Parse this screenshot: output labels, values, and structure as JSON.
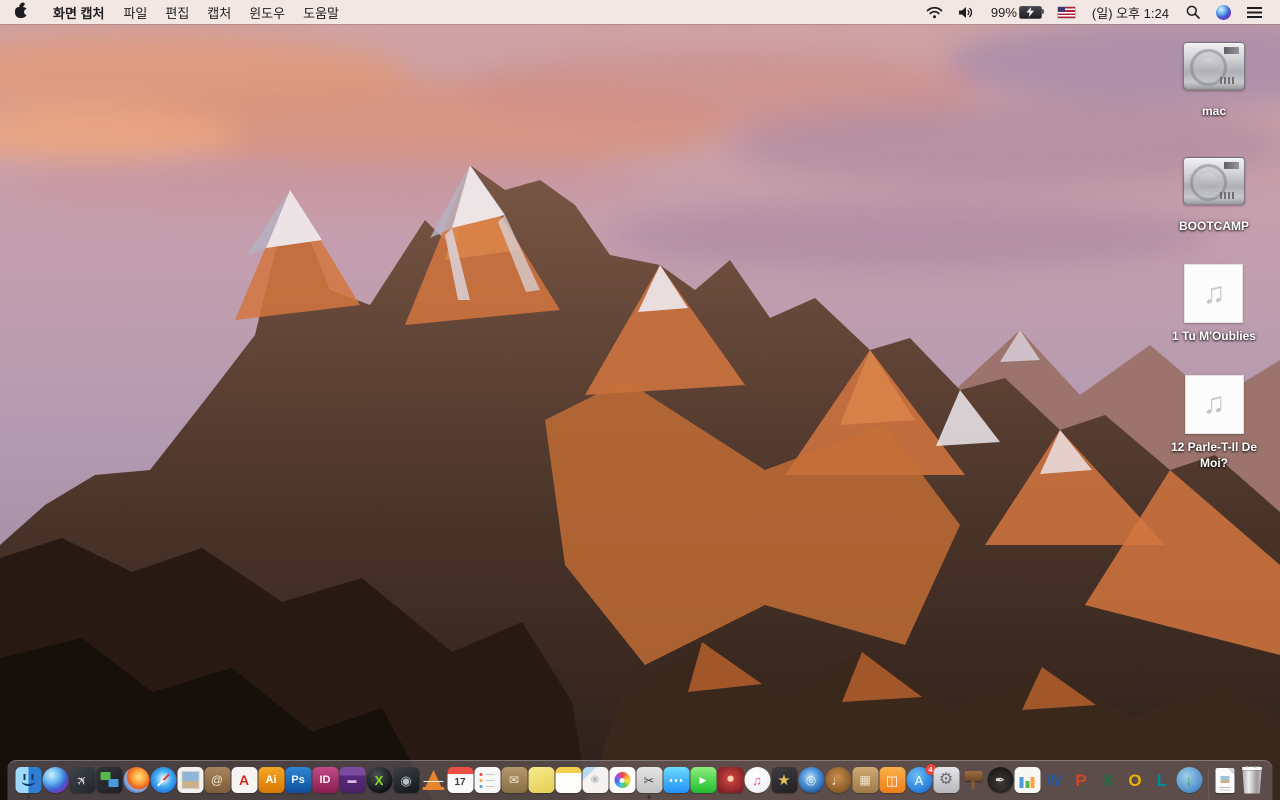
{
  "menu_bar": {
    "app_name": "화면 캡처",
    "menus": [
      "파일",
      "편집",
      "캡처",
      "윈도우",
      "도움말"
    ],
    "status": {
      "battery_percent": "99%",
      "clock": "(일) 오후 1:24"
    },
    "colors": {
      "bar_bg": "#f4e9e6",
      "text": "#1d1d1f"
    }
  },
  "desktop": {
    "icons": [
      {
        "name": "volume-mac",
        "kind": "hdd",
        "label": "mac"
      },
      {
        "name": "volume-bootcamp",
        "kind": "hdd",
        "label": "BOOTCAMP"
      },
      {
        "name": "audio-file-1-tu-moublies",
        "kind": "audio",
        "label": "1 Tu M'Oublies",
        "glyph": "♫"
      },
      {
        "name": "audio-file-12-parle-t-il-de-moi",
        "kind": "audio",
        "label": "12 Parle-T-Il De Moi?",
        "glyph": "♫"
      }
    ]
  },
  "dock": {
    "apps": [
      {
        "name": "finder",
        "cls": "ic-finder",
        "shape": "s",
        "bg": "linear-gradient(90deg,#9fd8fb 0%,#9fd8fb 50%,#2e7fd4 50%,#2e7fd4 100%)",
        "running": true
      },
      {
        "name": "siri",
        "shape": "c",
        "bg": "radial-gradient(circle at 35% 30%,#cfeffc 0%,#5fb2ee 35%,#3b5fd0 60%,#8a2ec2 80%,#1a0f3d 100%)"
      },
      {
        "name": "launchpad",
        "shape": "s",
        "bg": "linear-gradient(145deg,#3e444c,#22262b)",
        "glyph": "✈",
        "fg": "#cdd2d9",
        "fs": 13,
        "rot": -45
      },
      {
        "name": "mission-control",
        "cls": "ic-mc",
        "shape": "s",
        "bg": "linear-gradient(145deg,#31353a,#1c1f23)"
      },
      {
        "name": "firefox",
        "shape": "c",
        "bg": "radial-gradient(circle at 60% 38%,#ffe27a 0%,#f9a13c 30%,#ea5b1e 52%,#8fb0e0 58%,#2a4f9e 90%)"
      },
      {
        "name": "safari",
        "cls": "ic-safari",
        "shape": "c",
        "bg": "radial-gradient(circle at 50% 45%,#eaf6fd 0%,#bfe4fa 14%,#47aef2 40%,#1565d8 85%)"
      },
      {
        "name": "preview",
        "cls": "ic-preview",
        "shape": "s",
        "bg": "#f2f1ef"
      },
      {
        "name": "contacts",
        "shape": "s",
        "bg": "linear-gradient(180deg,#a8845c,#7b5d3c)",
        "glyph": "@",
        "fg": "#f3e8d2",
        "fs": 12
      },
      {
        "name": "acrobat-reader",
        "shape": "s",
        "bg": "#f5f4f2",
        "glyph": "A",
        "fg": "#d0281e",
        "fs": 14,
        "wt": 700
      },
      {
        "name": "illustrator",
        "shape": "s",
        "bg": "linear-gradient(180deg,#f5a623,#d67a06)",
        "glyph": "Ai",
        "fg": "#ffffff",
        "fs": 11,
        "wt": 700
      },
      {
        "name": "photoshop",
        "shape": "s",
        "bg": "linear-gradient(180deg,#2f86d3,#0f4f9a)",
        "glyph": "Ps",
        "fg": "#eaf4ff",
        "fs": 11,
        "wt": 700
      },
      {
        "name": "indesign",
        "shape": "s",
        "bg": "linear-gradient(180deg,#c24a86,#8a1d52)",
        "glyph": "ID",
        "fg": "#fdeef6",
        "fs": 11,
        "wt": 700
      },
      {
        "name": "toast-burner",
        "shape": "s",
        "bg": "linear-gradient(180deg,#7b4ba0 0%,#7b4ba0 32%,#56297a 32%,#4a2268 100%)",
        "glyph": "▬",
        "fg": "#d3bde4",
        "fs": 9
      },
      {
        "name": "x-converter",
        "shape": "c",
        "bg": "radial-gradient(circle at 40% 32%,#4c5156,#0e1012 75%)",
        "glyph": "X",
        "fg": "#8ddc2a",
        "fs": 13,
        "wt": 700
      },
      {
        "name": "disk-tool",
        "shape": "s",
        "bg": "linear-gradient(160deg,#3c4046,#15171a)",
        "glyph": "◉",
        "fg": "#b9c2cc",
        "fs": 13
      },
      {
        "name": "vlc",
        "cls": "ic-vlc",
        "shape": "n"
      },
      {
        "name": "calendar",
        "shape": "s",
        "bg": "linear-gradient(180deg,#ec5044 0px,#ec5044 7px,#fbfbfb 7px)",
        "glyph": "17",
        "fg": "#3a3a3c",
        "fs": 10,
        "wt": 700,
        "mt": 6
      },
      {
        "name": "reminders",
        "cls": "ic-rem",
        "shape": "s",
        "bg": "#f7f7f7"
      },
      {
        "name": "mail-archive-box",
        "shape": "s",
        "bg": "linear-gradient(180deg,#b5986b,#8a6f44)",
        "glyph": "✉",
        "fg": "#efe6d4",
        "fs": 12
      },
      {
        "name": "stickies",
        "shape": "s",
        "bg": "linear-gradient(160deg,#f6e98a,#e6cf55)"
      },
      {
        "name": "notes",
        "shape": "s",
        "bg": "linear-gradient(180deg,#f3cf4e 0px,#f3cf4e 6px,#fdfdfb 6px)"
      },
      {
        "name": "documents-seal",
        "shape": "s",
        "bg": "linear-gradient(135deg,#bcd9f2 0%,#bcd9f2 26%,#f4f3f1 26%)",
        "glyph": "◉",
        "fg": "#b9b9bd",
        "fs": 10
      },
      {
        "name": "photos",
        "cls": "ic-photos",
        "shape": "s",
        "bg": "#fbfbfb"
      },
      {
        "name": "screen-capture",
        "shape": "s",
        "bg": "linear-gradient(180deg,#e5e5e5,#c2c2c4)",
        "glyph": "✂",
        "fg": "#46464a",
        "fs": 13,
        "running": true
      },
      {
        "name": "messages",
        "shape": "s",
        "bg": "linear-gradient(180deg,#6edcfc,#1f8ff7)",
        "glyph": "⋯",
        "fg": "#ffffff",
        "fs": 15,
        "wt": 700
      },
      {
        "name": "facetime",
        "shape": "s",
        "bg": "linear-gradient(180deg,#8dee7c,#1fbe2e)",
        "glyph": "▶",
        "fg": "#ffffff",
        "fs": 9
      },
      {
        "name": "photo-booth",
        "shape": "s",
        "bg": "radial-gradient(circle at 50% 45%,#f6d3a8 0%,#f6d3a8 14%,#c2403e 18%,#7a1b22 90%)"
      },
      {
        "name": "itunes",
        "shape": "c",
        "bg": "radial-gradient(circle at 40% 35%,#ffffff 0%,#f4f4f8 60%,#d9d9e2 100%)",
        "glyph": "♫",
        "fg": "#e14e8c",
        "fs": 13
      },
      {
        "name": "imovie",
        "shape": "s",
        "bg": "linear-gradient(160deg,#3e3e42,#202024)",
        "glyph": "★",
        "fg": "#e3c05a",
        "fs": 15
      },
      {
        "name": "dvd-player",
        "shape": "c",
        "bg": "radial-gradient(circle at 45% 40%,#bfe0f5 0%,#4e94d8 40%,#113f85 90%)",
        "glyph": "◎",
        "fg": "rgba(255,255,255,0.8)",
        "fs": 12
      },
      {
        "name": "garageband",
        "shape": "c",
        "bg": "radial-gradient(circle at 45% 40%,#c98f4e,#7e5222 80%)",
        "glyph": "♩",
        "fg": "#f6e8cf",
        "fs": 13
      },
      {
        "name": "bulletin-board",
        "shape": "s",
        "bg": "linear-gradient(180deg,#cfa873,#a07a48)",
        "glyph": "▦",
        "fg": "#f0e4cc",
        "fs": 12
      },
      {
        "name": "ibooks",
        "shape": "s",
        "bg": "linear-gradient(180deg,#f9b24a,#ee7d1c)",
        "glyph": "◫",
        "fg": "#ffffff",
        "fs": 13
      },
      {
        "name": "app-store",
        "shape": "c",
        "bg": "radial-gradient(circle at 40% 32%,#6cc1f5,#2071d6 80%)",
        "glyph": "A",
        "fg": "#ffffff",
        "fs": 13,
        "badge": "4"
      },
      {
        "name": "system-preferences",
        "shape": "s",
        "bg": "linear-gradient(180deg,#e6e6e9,#b6b6bd)",
        "glyph": "⚙",
        "fg": "#6b6b72",
        "fs": 16
      },
      {
        "name": "keynote-podium",
        "cls": "ic-podium",
        "shape": "n"
      },
      {
        "name": "pages-inkwell",
        "shape": "c",
        "bg": "radial-gradient(circle at 50% 60%,#3c3a38,#181614 85%)",
        "glyph": "✒",
        "fg": "#e8e0d0",
        "fs": 12
      },
      {
        "name": "numbers-chart",
        "cls": "ic-bars",
        "shape": "s",
        "bg": "#f6f6f4"
      },
      {
        "name": "ms-word",
        "shape": "n",
        "glyph": "W",
        "fg": "#2b579a",
        "fs": 17,
        "wt": 700
      },
      {
        "name": "ms-powerpoint",
        "shape": "n",
        "glyph": "P",
        "fg": "#d24625",
        "fs": 17,
        "wt": 700
      },
      {
        "name": "ms-excel",
        "shape": "n",
        "glyph": "X",
        "fg": "#1e7145",
        "fs": 17,
        "wt": 700
      },
      {
        "name": "ms-outlook",
        "shape": "n",
        "glyph": "O",
        "fg": "#eab308",
        "fs": 17,
        "wt": 700
      },
      {
        "name": "ms-lync",
        "shape": "n",
        "glyph": "L",
        "fg": "#008b9a",
        "fs": 17,
        "wt": 700
      },
      {
        "name": "download-manager",
        "shape": "c",
        "bg": "radial-gradient(circle at 40% 35%,#9fd0ea,#4889c8 75%)",
        "glyph": "↓",
        "fg": "#2fae3e",
        "fs": 14,
        "wt": 700
      }
    ],
    "files": [
      {
        "name": "minimized-document",
        "cls": "ic-doc"
      },
      {
        "name": "trash",
        "cls": "ic-trash"
      }
    ]
  }
}
